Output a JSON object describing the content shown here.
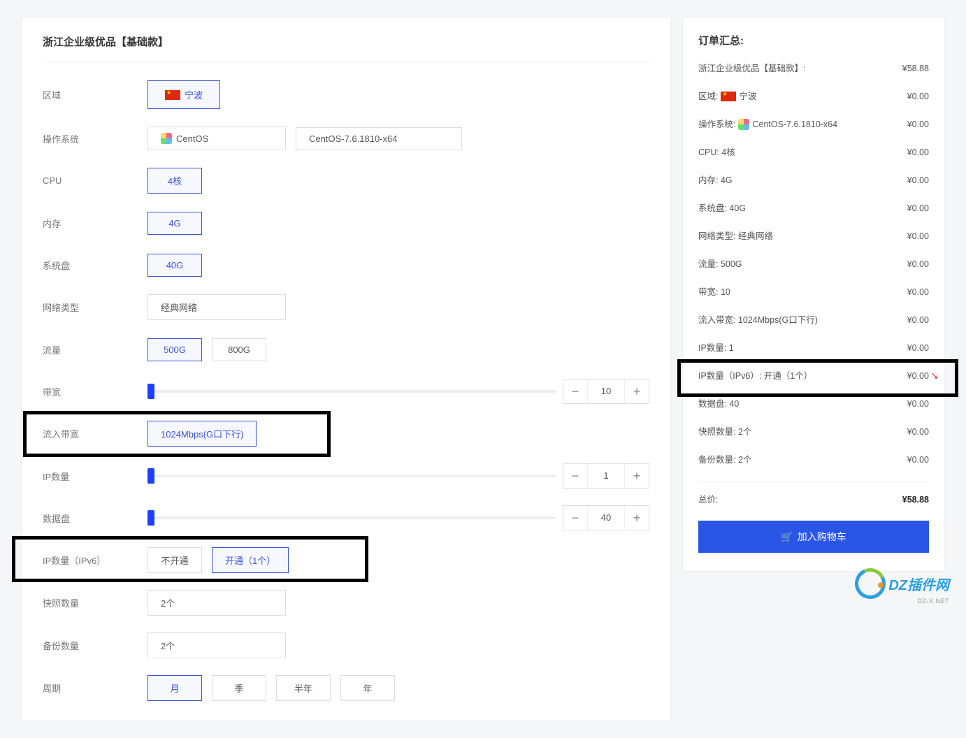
{
  "product_title": "浙江企业级优品【基础款】",
  "labels": {
    "region": "区域",
    "os": "操作系统",
    "cpu": "CPU",
    "memory": "内存",
    "system_disk": "系统盘",
    "network_type": "网络类型",
    "traffic": "流量",
    "bandwidth": "带宽",
    "ingress_bandwidth": "流入带宽",
    "ip_count": "IP数量",
    "data_disk": "数据盘",
    "ipv6": "IP数量（IPv6）",
    "snapshot": "快照数量",
    "backup": "备份数量",
    "period": "周期"
  },
  "options": {
    "region": "宁波",
    "os_family": "CentOS",
    "os_version": "CentOS-7.6.1810-x64",
    "cpu": "4核",
    "memory": "4G",
    "system_disk": "40G",
    "network_type": "经典网络",
    "traffic": [
      "500G",
      "800G"
    ],
    "traffic_selected": 0,
    "ingress_bandwidth": "1024Mbps(G口下行)",
    "ipv6": [
      "不开通",
      "开通（1个）"
    ],
    "ipv6_selected": 1,
    "snapshot": "2个",
    "backup": "2个",
    "period": [
      "月",
      "季",
      "半年",
      "年"
    ],
    "period_selected": 0
  },
  "steppers": {
    "bandwidth": "10",
    "ip_count": "1",
    "data_disk": "40"
  },
  "summary": {
    "title": "订单汇总:",
    "items": [
      {
        "label": "浙江企业级优品【基础款】:",
        "price": "¥58.88"
      },
      {
        "label": "区域: 宁波",
        "price": "¥0.00",
        "flag": true
      },
      {
        "label": "操作系统: CentOS-7.6.1810-x64",
        "price": "¥0.00",
        "os": true
      },
      {
        "label": "CPU: 4核",
        "price": "¥0.00"
      },
      {
        "label": "内存: 4G",
        "price": "¥0.00"
      },
      {
        "label": "系统盘: 40G",
        "price": "¥0.00"
      },
      {
        "label": "网络类型: 经典网络",
        "price": "¥0.00"
      },
      {
        "label": "流量: 500G",
        "price": "¥0.00"
      },
      {
        "label": "带宽: 10",
        "price": "¥0.00"
      },
      {
        "label": "流入带宽: 1024Mbps(G口下行)",
        "price": "¥0.00"
      },
      {
        "label": "IP数量: 1",
        "price": "¥0.00"
      },
      {
        "label": "IP数量（IPv6）: 开通（1个）",
        "price": "¥0.00",
        "highlight": true
      },
      {
        "label": "数据盘: 40",
        "price": "¥0.00"
      },
      {
        "label": "快照数量: 2个",
        "price": "¥0.00"
      },
      {
        "label": "备份数量: 2个",
        "price": "¥0.00"
      }
    ],
    "total_label": "总价:",
    "total_price": "¥58.88",
    "cart_button": "加入购物车"
  },
  "watermark": {
    "brand": "DZ插件网",
    "sub": "DZ-X.NET"
  },
  "icons": {
    "minus": "−",
    "plus": "+",
    "cart": "🛒"
  }
}
